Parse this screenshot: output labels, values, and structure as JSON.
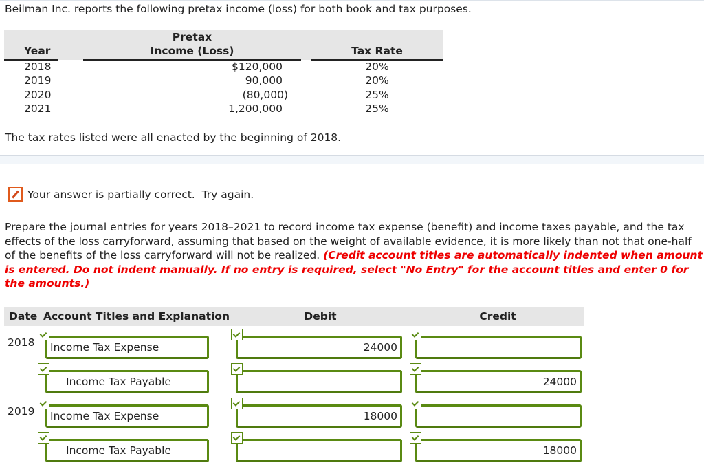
{
  "intro": "Beilman Inc. reports the following pretax income (loss) for both book and tax purposes.",
  "data_table": {
    "headers": {
      "year": "Year",
      "income_line1": "Pretax",
      "income_line2": "Income (Loss)",
      "tax_rate": "Tax Rate"
    },
    "rows": [
      {
        "year": "2018",
        "income": "$120,000",
        "rate": "20%"
      },
      {
        "year": "2019",
        "income": "90,000",
        "rate": "20%"
      },
      {
        "year": "2020",
        "income": "(80,000)",
        "rate": "25%"
      },
      {
        "year": "2021",
        "income": "1,200,000",
        "rate": "25%"
      }
    ]
  },
  "note": "The tax rates listed were all enacted by the beginning of 2018.",
  "status": {
    "icon": "pencil-icon",
    "text": "Your answer is partially correct.  Try again.",
    "accent_color": "#e05a1c"
  },
  "instructions": {
    "text": "Prepare the journal entries for years 2018–2021 to record income tax expense (benefit) and income taxes payable, and the tax effects of the loss carryforward, assuming that based on the weight of available evidence, it is more likely than not that one-half of the benefits of the loss carryforward will not be realized. ",
    "emphasis": "(Credit account titles are automatically indented when amount is entered. Do not indent manually. If no entry is required, select \"No Entry\" for the account titles and enter 0 for the amounts.)",
    "emphasis_color": "#ee0000"
  },
  "journal": {
    "headers": {
      "date": "Date",
      "account": "Account Titles and Explanation",
      "debit": "Debit",
      "credit": "Credit"
    },
    "correct_color": "#5a8a12",
    "entries": [
      {
        "year": "2018",
        "account": "Income Tax Expense",
        "debit": "24000",
        "credit": ""
      },
      {
        "year": "",
        "account": "Income Tax Payable",
        "debit": "",
        "credit": "24000"
      },
      {
        "year": "2019",
        "account": "Income Tax Expense",
        "debit": "18000",
        "credit": ""
      },
      {
        "year": "",
        "account": "Income Tax Payable",
        "debit": "",
        "credit": "18000"
      }
    ]
  }
}
